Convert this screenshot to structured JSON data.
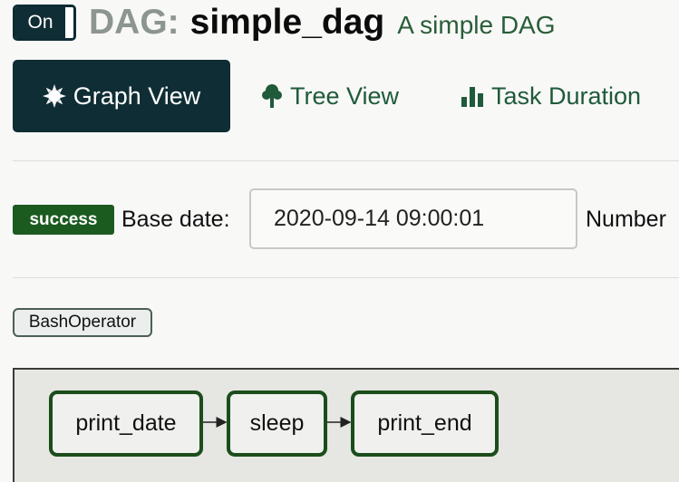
{
  "header": {
    "toggle_label": "On",
    "prefix": "DAG:",
    "dag_id": "simple_dag",
    "description": "A simple DAG"
  },
  "tabs": [
    {
      "label": "Graph View",
      "icon": "sun-icon",
      "active": true
    },
    {
      "label": "Tree View",
      "icon": "tree-icon",
      "active": false
    },
    {
      "label": "Task Duration",
      "icon": "bar-chart-icon",
      "active": false
    }
  ],
  "controls": {
    "state": "success",
    "base_date_label": "Base date:",
    "base_date_value": "2020-09-14 09:00:01",
    "number_label": "Number"
  },
  "legend": {
    "operator": "BashOperator"
  },
  "graph": {
    "nodes": [
      "print_date",
      "sleep",
      "print_end"
    ],
    "edges": [
      [
        "print_date",
        "sleep"
      ],
      [
        "sleep",
        "print_end"
      ]
    ]
  },
  "colors": {
    "primary_dark": "#0f2d34",
    "success": "#1b5b1f",
    "node_border": "#1b4d1b",
    "tab_text": "#1f5a3a",
    "dag_prefix": "#8c9590"
  }
}
